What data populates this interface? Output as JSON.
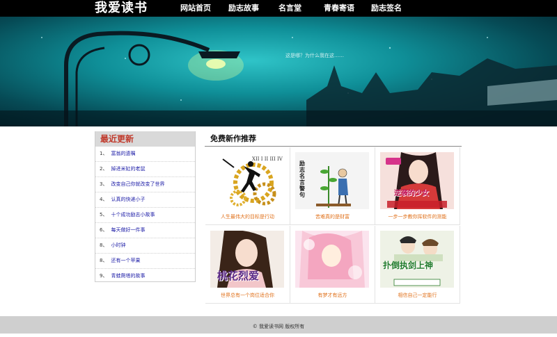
{
  "header": {
    "logo": "我爱读书",
    "nav": [
      "网站首页",
      "励志故事",
      "名言堂",
      "青春寄语",
      "励志签名"
    ]
  },
  "banner": {
    "caption": "这是哪？为什么我在这……"
  },
  "sidebar": {
    "title": "最近更新",
    "items": [
      {
        "num": "1、",
        "label": "富翁的遗嘱"
      },
      {
        "num": "2、",
        "label": "掉进米缸的老鼠"
      },
      {
        "num": "3、",
        "label": "改变自己你就改变了世界"
      },
      {
        "num": "4、",
        "label": "认真的快递小子"
      },
      {
        "num": "5、",
        "label": "十个成功励志小故事"
      },
      {
        "num": "6、",
        "label": "每天做好一件事"
      },
      {
        "num": "8、",
        "label": "小时钟"
      },
      {
        "num": "8、",
        "label": "还有一个苹果"
      },
      {
        "num": "9、",
        "label": "青蛙爬塔的故事"
      }
    ]
  },
  "main": {
    "title": "免费新作推荐",
    "books": [
      {
        "caption": "人生最伟大的目标是行动",
        "cover_text": ""
      },
      {
        "caption": "苦难真的是财富",
        "cover_text": "励志名言警句"
      },
      {
        "caption": "一步一步教你挥软件的测能",
        "cover_text": "逆袭的少女"
      },
      {
        "caption": "世界总有一个岗位适合你",
        "cover_text": "桃花烈爱"
      },
      {
        "caption": "有梦才有远方",
        "cover_text": ""
      },
      {
        "caption": "相信自己一定能行",
        "cover_text": "扑倒执剑上神"
      }
    ]
  },
  "footer": {
    "text": "© 我爱读书网 版权所有"
  },
  "colors": {
    "topbar": "#000000",
    "sidebar_title": "#c0392b",
    "link": "#1a1aa6",
    "caption": "#e0711b",
    "footer_bg": "#cfcfcf"
  }
}
